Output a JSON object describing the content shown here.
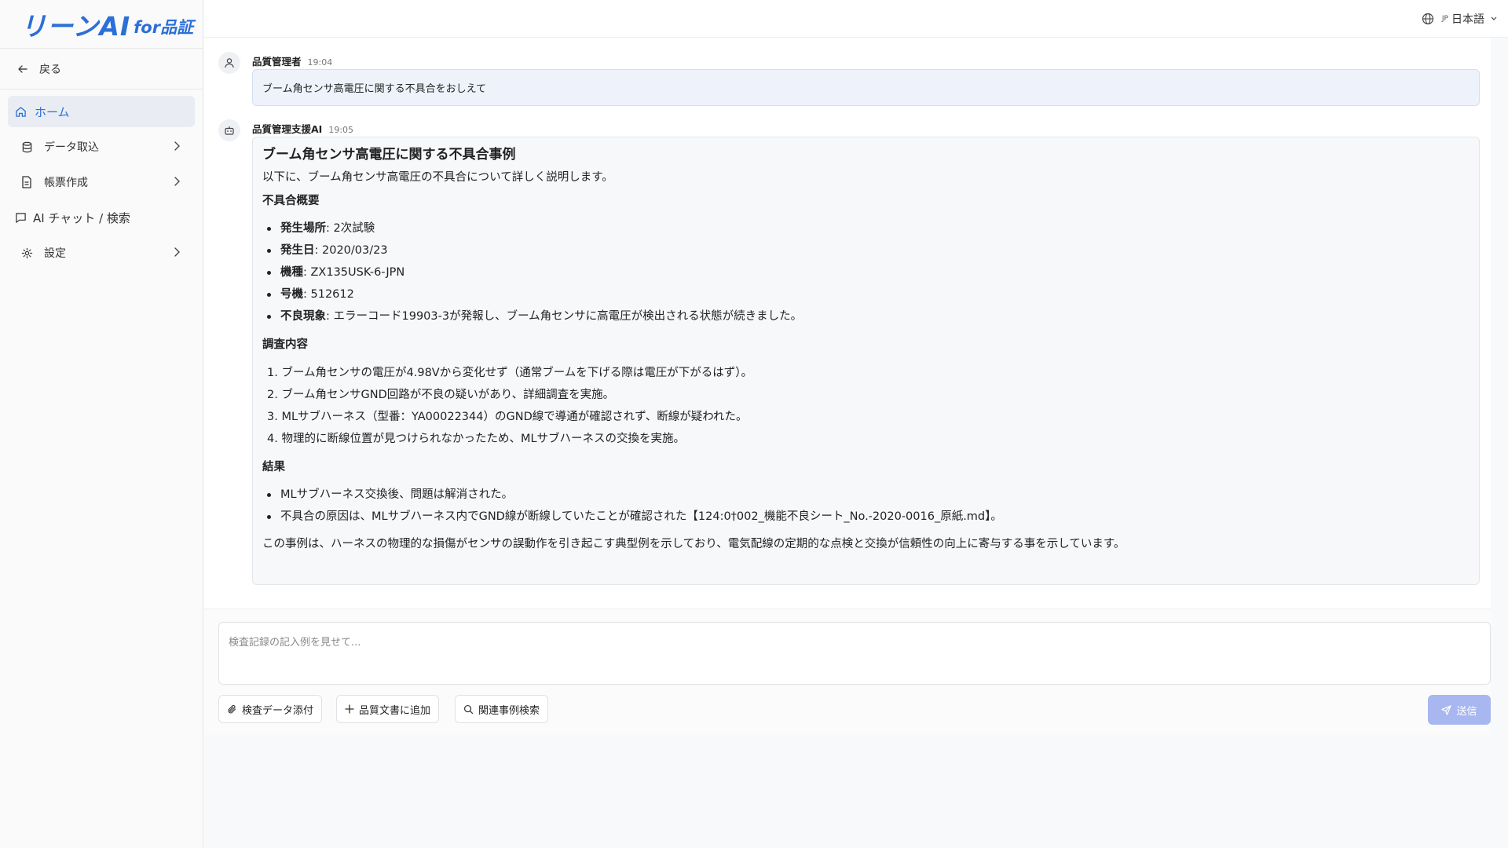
{
  "app": {
    "logo_main": "リーンAI",
    "logo_sub": "for品証"
  },
  "sidebar": {
    "back_label": "戻る",
    "items": [
      {
        "label": "ホーム",
        "icon": "home-icon"
      },
      {
        "label": "データ取込",
        "icon": "database-icon"
      },
      {
        "label": "帳票作成",
        "icon": "document-icon"
      },
      {
        "label": "AI チャット / 検索",
        "icon": "chat-icon"
      },
      {
        "label": "設定",
        "icon": "gear-icon"
      }
    ]
  },
  "header": {
    "lang_code": "JP",
    "lang_label": "日本語"
  },
  "messages": {
    "user": {
      "name": "品質管理者",
      "time": "19:04",
      "text": "ブーム角センサ高電圧に関する不具合をおしえて"
    },
    "ai": {
      "name": "品質管理支援AI",
      "time": "19:05",
      "title": "ブーム角センサ高電圧に関する不具合事例",
      "intro": "以下に、ブーム角センサ高電圧の不具合について詳しく説明します。",
      "summary_heading": "不具合概要",
      "summary": [
        {
          "key": "発生場所",
          "value": ": 2次試験"
        },
        {
          "key": "発生日",
          "value": ": 2020/03/23"
        },
        {
          "key": "機種",
          "value": ": ZX135USK-6-JPN"
        },
        {
          "key": "号機",
          "value": ": 512612"
        },
        {
          "key": "不良現象",
          "value": ": エラーコード19903-3が発報し、ブーム角センサに高電圧が検出される状態が続きました。"
        }
      ],
      "investigation_heading": "調査内容",
      "investigation": [
        "1. ブーム角センサの電圧が4.98Vから変化せず（通常ブームを下げる際は電圧が下がるはず）。",
        "2. ブーム角センサGND回路が不良の疑いがあり、詳細調査を実施。",
        "3. MLサブハーネス（型番：YA00022344）のGND線で導通が確認されず、断線が疑われた。",
        "4. 物理的に断線位置が見つけられなかったため、MLサブハーネスの交換を実施。"
      ],
      "result_heading": "結果",
      "results": [
        "MLサブハーネス交換後、問題は解消された。",
        "不具合の原因は、MLサブハーネス内でGND線が断線していたことが確認された【124:0†002_機能不良シート_No.-2020-0016_原紙.md】。"
      ],
      "closing": "この事例は、ハーネスの物理的な損傷がセンサの誤動作を引き起こす典型例を示しており、電気配線の定期的な点検と交換が信頼性の向上に寄与する事を示しています。"
    }
  },
  "composer": {
    "placeholder": "検査記録の記入例を見せて...",
    "attach_label": "検査データ添付",
    "add_doc_label": "品質文書に追加",
    "search_label": "関連事例検索",
    "send_label": "送信"
  },
  "colors": {
    "accent": "#2b6fd8",
    "send_button": "#a9b7f0",
    "user_bubble": "#eef3fb"
  }
}
